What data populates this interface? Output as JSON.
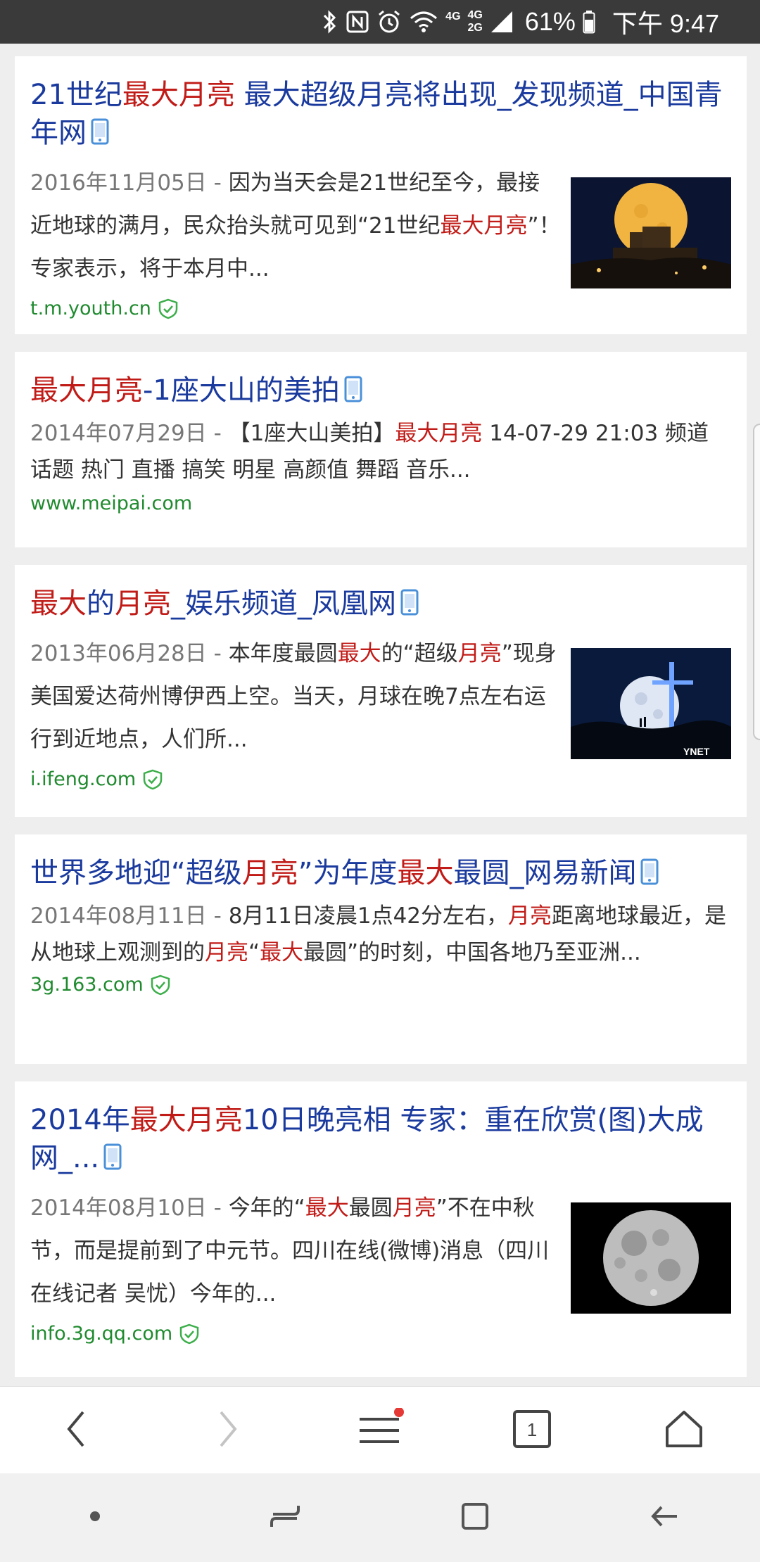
{
  "status_bar": {
    "network_top": "4G",
    "network_mid": "4G",
    "network_bot": "2G",
    "battery": "61%",
    "time": "下午 9:47"
  },
  "results": [
    {
      "title_parts": [
        {
          "text": "21世纪",
          "hl": false
        },
        {
          "text": "最大月亮",
          "hl": true
        },
        {
          "text": " 最大超级月亮将出现_发现频道_中国青年网",
          "hl": false
        }
      ],
      "date": "2016年11月05日 - ",
      "snippet_parts": [
        {
          "text": "因为当天会是21世纪至今，最接近地球的满月，民众抬头就可见到“21世纪",
          "hl": false
        },
        {
          "text": "最大月亮",
          "hl": true
        },
        {
          "text": "”！专家表示，将于本月中...",
          "hl": false
        }
      ],
      "url": "t.m.youth.cn",
      "verified": true,
      "thumb": "moon-castle"
    },
    {
      "title_parts": [
        {
          "text": "最大月亮",
          "hl": true
        },
        {
          "text": "-1座大山的美拍",
          "hl": false
        }
      ],
      "date": "2014年07月29日 - ",
      "snippet_parts": [
        {
          "text": "【1座大山美拍】",
          "hl": false
        },
        {
          "text": "最大月亮",
          "hl": true
        },
        {
          "text": " 14-07-29 21:03 频道 话题 热门 直播 搞笑 明星 高颜值 舞蹈 音乐...",
          "hl": false
        }
      ],
      "url": "www.meipai.com",
      "verified": false,
      "thumb": null
    },
    {
      "title_parts": [
        {
          "text": "最大",
          "hl": true
        },
        {
          "text": "的",
          "hl": false
        },
        {
          "text": "月亮",
          "hl": true
        },
        {
          "text": "_娱乐频道_凤凰网",
          "hl": false
        }
      ],
      "date": "2013年06月28日 - ",
      "snippet_parts": [
        {
          "text": "本年度最圆",
          "hl": false
        },
        {
          "text": "最大",
          "hl": true
        },
        {
          "text": "的“超级",
          "hl": false
        },
        {
          "text": "月亮",
          "hl": true
        },
        {
          "text": "”现身美国爱达荷州博伊西上空。当天，月球在晚7点左右运行到近地点，人们所...",
          "hl": false
        }
      ],
      "url": "i.ifeng.com",
      "verified": true,
      "thumb": "moon-cross",
      "thumb_watermark": "YNET"
    },
    {
      "title_parts": [
        {
          "text": "世界多地迎“超级",
          "hl": false
        },
        {
          "text": "月亮",
          "hl": true
        },
        {
          "text": "”为年度",
          "hl": false
        },
        {
          "text": "最大",
          "hl": true
        },
        {
          "text": "最圆_网易新闻",
          "hl": false
        }
      ],
      "date": "2014年08月11日 - ",
      "snippet_parts": [
        {
          "text": "8月11日凌晨1点42分左右，",
          "hl": false
        },
        {
          "text": "月亮",
          "hl": true
        },
        {
          "text": "距离地球最近，是从地球上观测到的",
          "hl": false
        },
        {
          "text": "月亮",
          "hl": true
        },
        {
          "text": "“",
          "hl": false
        },
        {
          "text": "最大",
          "hl": true
        },
        {
          "text": "最圆”的时刻，中国各地乃至亚洲...",
          "hl": false
        }
      ],
      "url": "3g.163.com",
      "verified": true,
      "thumb": null
    },
    {
      "title_parts": [
        {
          "text": "2014年",
          "hl": false
        },
        {
          "text": "最大月亮",
          "hl": true
        },
        {
          "text": "10日晚亮相 专家：重在欣赏(图)大成网_...",
          "hl": false
        }
      ],
      "date": "2014年08月10日 - ",
      "snippet_parts": [
        {
          "text": "今年的“",
          "hl": false
        },
        {
          "text": "最大",
          "hl": true
        },
        {
          "text": "最圆",
          "hl": false
        },
        {
          "text": "月亮",
          "hl": true
        },
        {
          "text": "”不在中秋节，而是提前到了中元节。四川在线(微博)消息（四川在线记者 吴忧）今年的...",
          "hl": false
        }
      ],
      "url": "info.3g.qq.com",
      "verified": true,
      "thumb": "full-moon"
    }
  ],
  "toolbar": {
    "tab_count": "1",
    "menu_badge_color": "#e53935"
  },
  "colors": {
    "title": "#1a3a9e",
    "highlight": "#c11b17",
    "url": "#1f8a2e",
    "date": "#777777"
  },
  "icons": {
    "back": "chevron-left-icon",
    "forward": "chevron-right-icon",
    "menu": "menu-icon",
    "tabs": "tabs-icon",
    "home": "home-icon"
  }
}
